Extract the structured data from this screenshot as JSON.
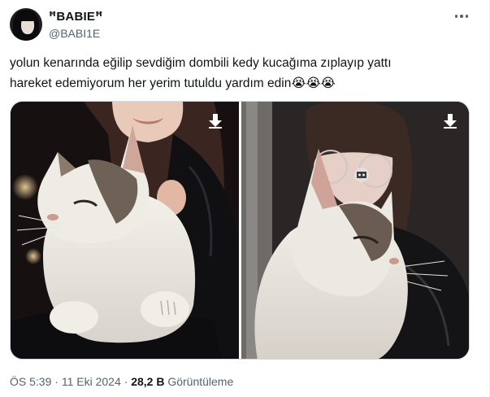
{
  "author": {
    "display_name": "ᴮᴬᴮᴵᴱ",
    "display_name_text": "ꟸBABIEꟸ",
    "handle": "@BABI1E"
  },
  "tweet": {
    "line1": "yolun kenarında eğilip sevdiğim dombili kedy kucağıma zıplayıp yattı",
    "line2": "hareket edemiyorum her yerim tutuldu yardım edin",
    "emojis": "😭😭😭"
  },
  "media": {
    "photos": [
      {
        "subject": "white and tabby cat held on lap, woman in black jacket",
        "icon": "download-arrow-icon"
      },
      {
        "subject": "white and tabby cat close-up, woman with glasses in background",
        "icon": "download-arrow-icon"
      }
    ]
  },
  "meta": {
    "time": "ÖS 5:39",
    "sep1": "·",
    "date": "11 Eki 2024",
    "sep2": "·",
    "views_count": "28,2 B",
    "views_label": "Görüntüleme"
  },
  "colors": {
    "text": "#0f1419",
    "secondary": "#536471",
    "border": "#cfd9de"
  }
}
